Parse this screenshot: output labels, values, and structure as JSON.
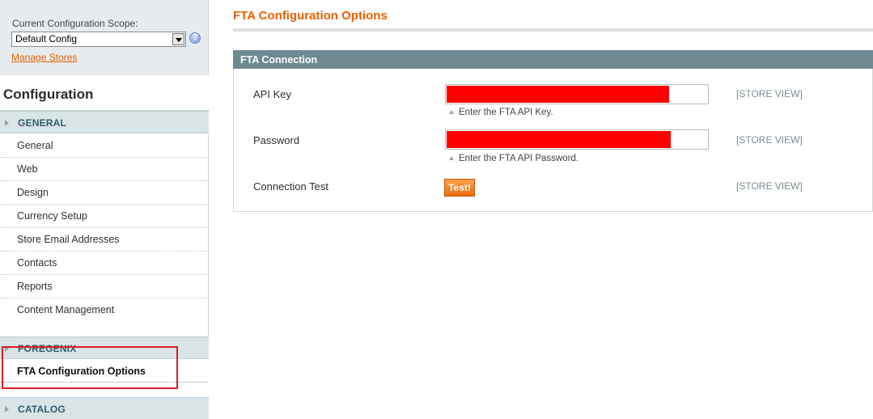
{
  "sidebar": {
    "scope_label": "Current Configuration Scope:",
    "scope_value": "Default Config",
    "manage_stores": "Manage Stores",
    "config_title": "Configuration",
    "sections": [
      {
        "label": "GENERAL",
        "items": [
          "General",
          "Web",
          "Design",
          "Currency Setup",
          "Store Email Addresses",
          "Contacts",
          "Reports",
          "Content Management"
        ]
      },
      {
        "label": "FOREGENIX",
        "items": [
          "FTA Configuration Options"
        ]
      },
      {
        "label": "CATALOG",
        "items": []
      }
    ]
  },
  "main": {
    "page_title": "FTA Configuration Options",
    "fieldset_title": "FTA Connection",
    "rows": [
      {
        "label": "API Key",
        "hint": "Enter the FTA API Key.",
        "scope": "[STORE VIEW]"
      },
      {
        "label": "Password",
        "hint": "Enter the FTA API Password.",
        "scope": "[STORE VIEW]"
      },
      {
        "label": "Connection Test",
        "button": "Test!",
        "scope": "[STORE VIEW]"
      }
    ]
  },
  "colors": {
    "accent": "#eb5e00",
    "fieldset_header": "#6f8992",
    "highlight_box": "#e01c24",
    "redaction": "#ff0000"
  },
  "icons": [
    "chevron-down-icon",
    "help-icon",
    "triangle-right-icon",
    "hint-triangle-icon"
  ]
}
